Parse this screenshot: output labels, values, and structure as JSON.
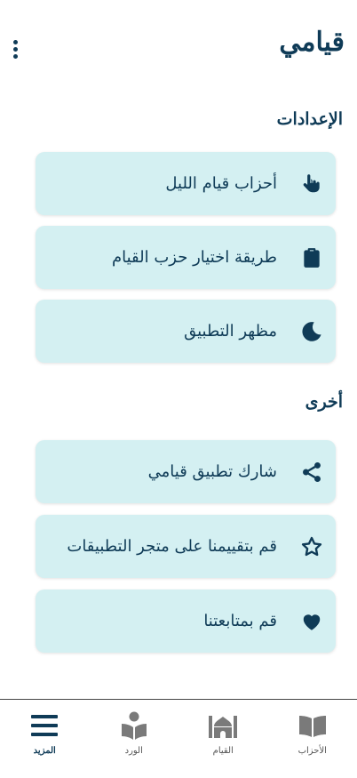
{
  "header": {
    "title": "قيامي",
    "menu_icon": "more-vertical-icon"
  },
  "sections": [
    {
      "title": "الإعدادات",
      "items": [
        {
          "label": "أحزاب قيام الليل",
          "icon": "hand-pointer-icon"
        },
        {
          "label": "طريقة اختيار حزب القيام",
          "icon": "clipboard-icon"
        },
        {
          "label": "مظهر التطبيق",
          "icon": "moon-icon"
        }
      ]
    },
    {
      "title": "أخرى",
      "items": [
        {
          "label": "شارك تطبيق قيامي",
          "icon": "share-icon"
        },
        {
          "label": "قم بتقييمنا على متجر التطبيقات",
          "icon": "star-icon"
        },
        {
          "label": "قم بمتابعتنا",
          "icon": "heart-icon"
        }
      ]
    }
  ],
  "bottom_nav": [
    {
      "label": "الأحزاب",
      "icon": "book-icon"
    },
    {
      "label": "القيام",
      "icon": "mosque-icon"
    },
    {
      "label": "الورد",
      "icon": "reader-icon"
    },
    {
      "label": "المزيد",
      "icon": "menu-icon",
      "active": true
    }
  ],
  "colors": {
    "primary": "#0f3b57",
    "card": "#d4f0f2",
    "muted": "#7a7a7a"
  }
}
